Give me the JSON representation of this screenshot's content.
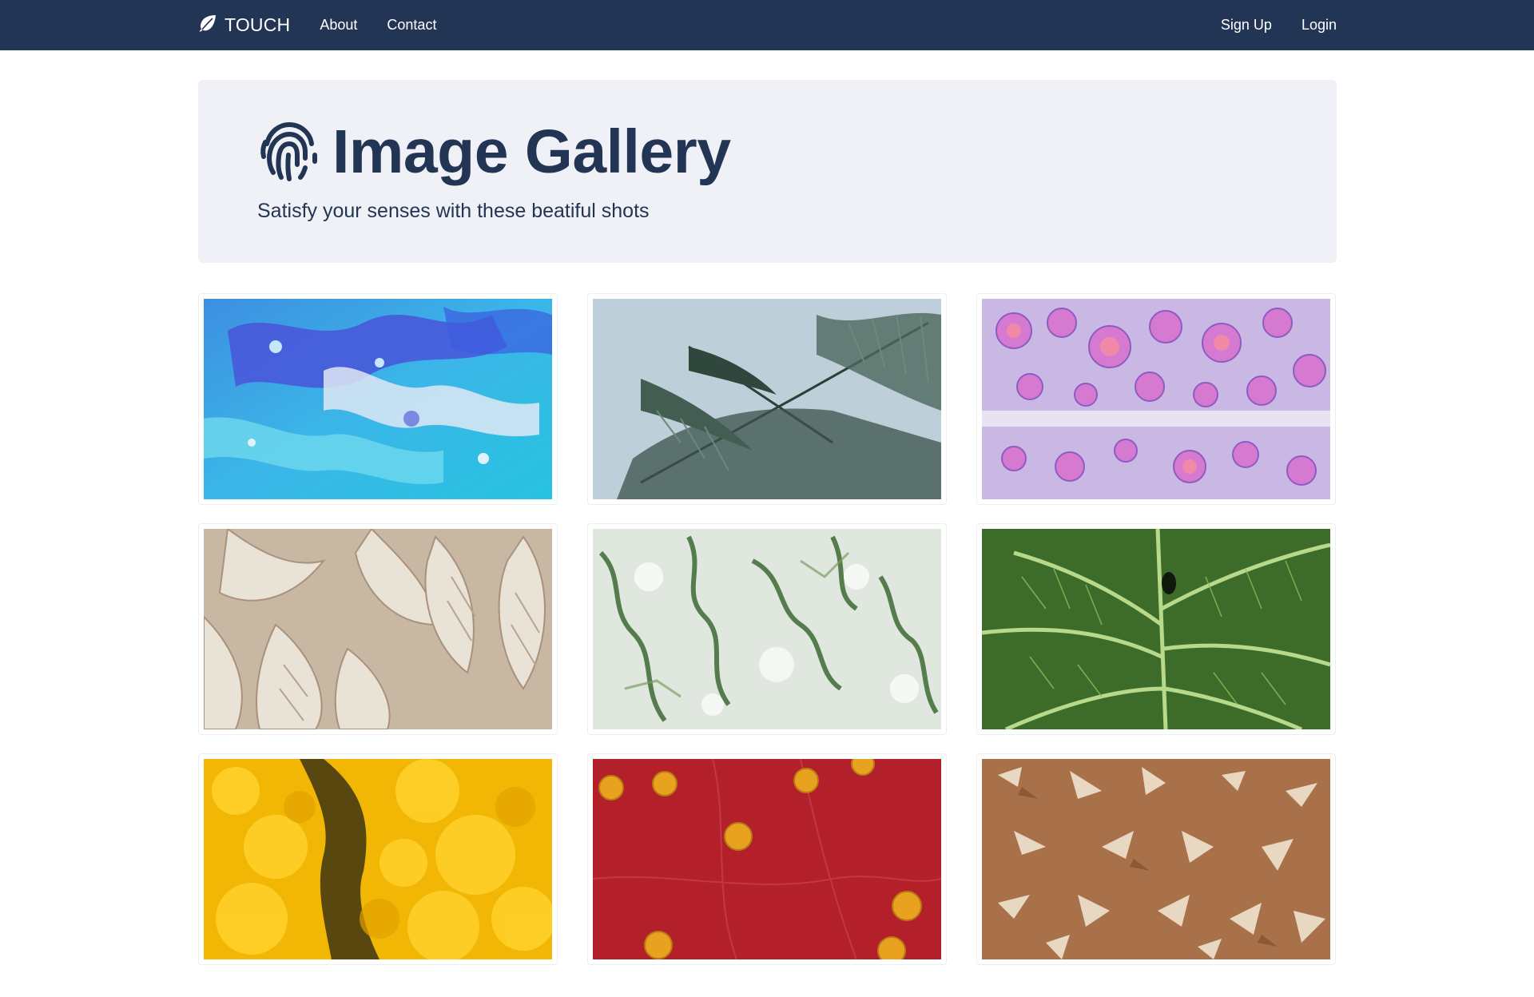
{
  "navbar": {
    "brand": "TOUCH",
    "links": [
      "About",
      "Contact"
    ],
    "right_links": [
      "Sign Up",
      "Login"
    ],
    "brand_icon": "leaf-icon"
  },
  "hero": {
    "title": "Image Gallery",
    "subtitle": "Satisfy your senses with these beatiful shots",
    "icon": "fingerprint-icon"
  },
  "gallery": {
    "images": [
      "blue-fluid-art-image",
      "fern-leaves-image",
      "pink-cells-image",
      "plaster-leaves-image",
      "green-marble-image",
      "green-leaf-veins-image",
      "yellow-flowers-image",
      "red-tennis-balls-image",
      "cracked-earth-image"
    ]
  },
  "colors": {
    "navbar": "#233554",
    "hero_bg": "#f0f1f6",
    "text": "#233554"
  }
}
